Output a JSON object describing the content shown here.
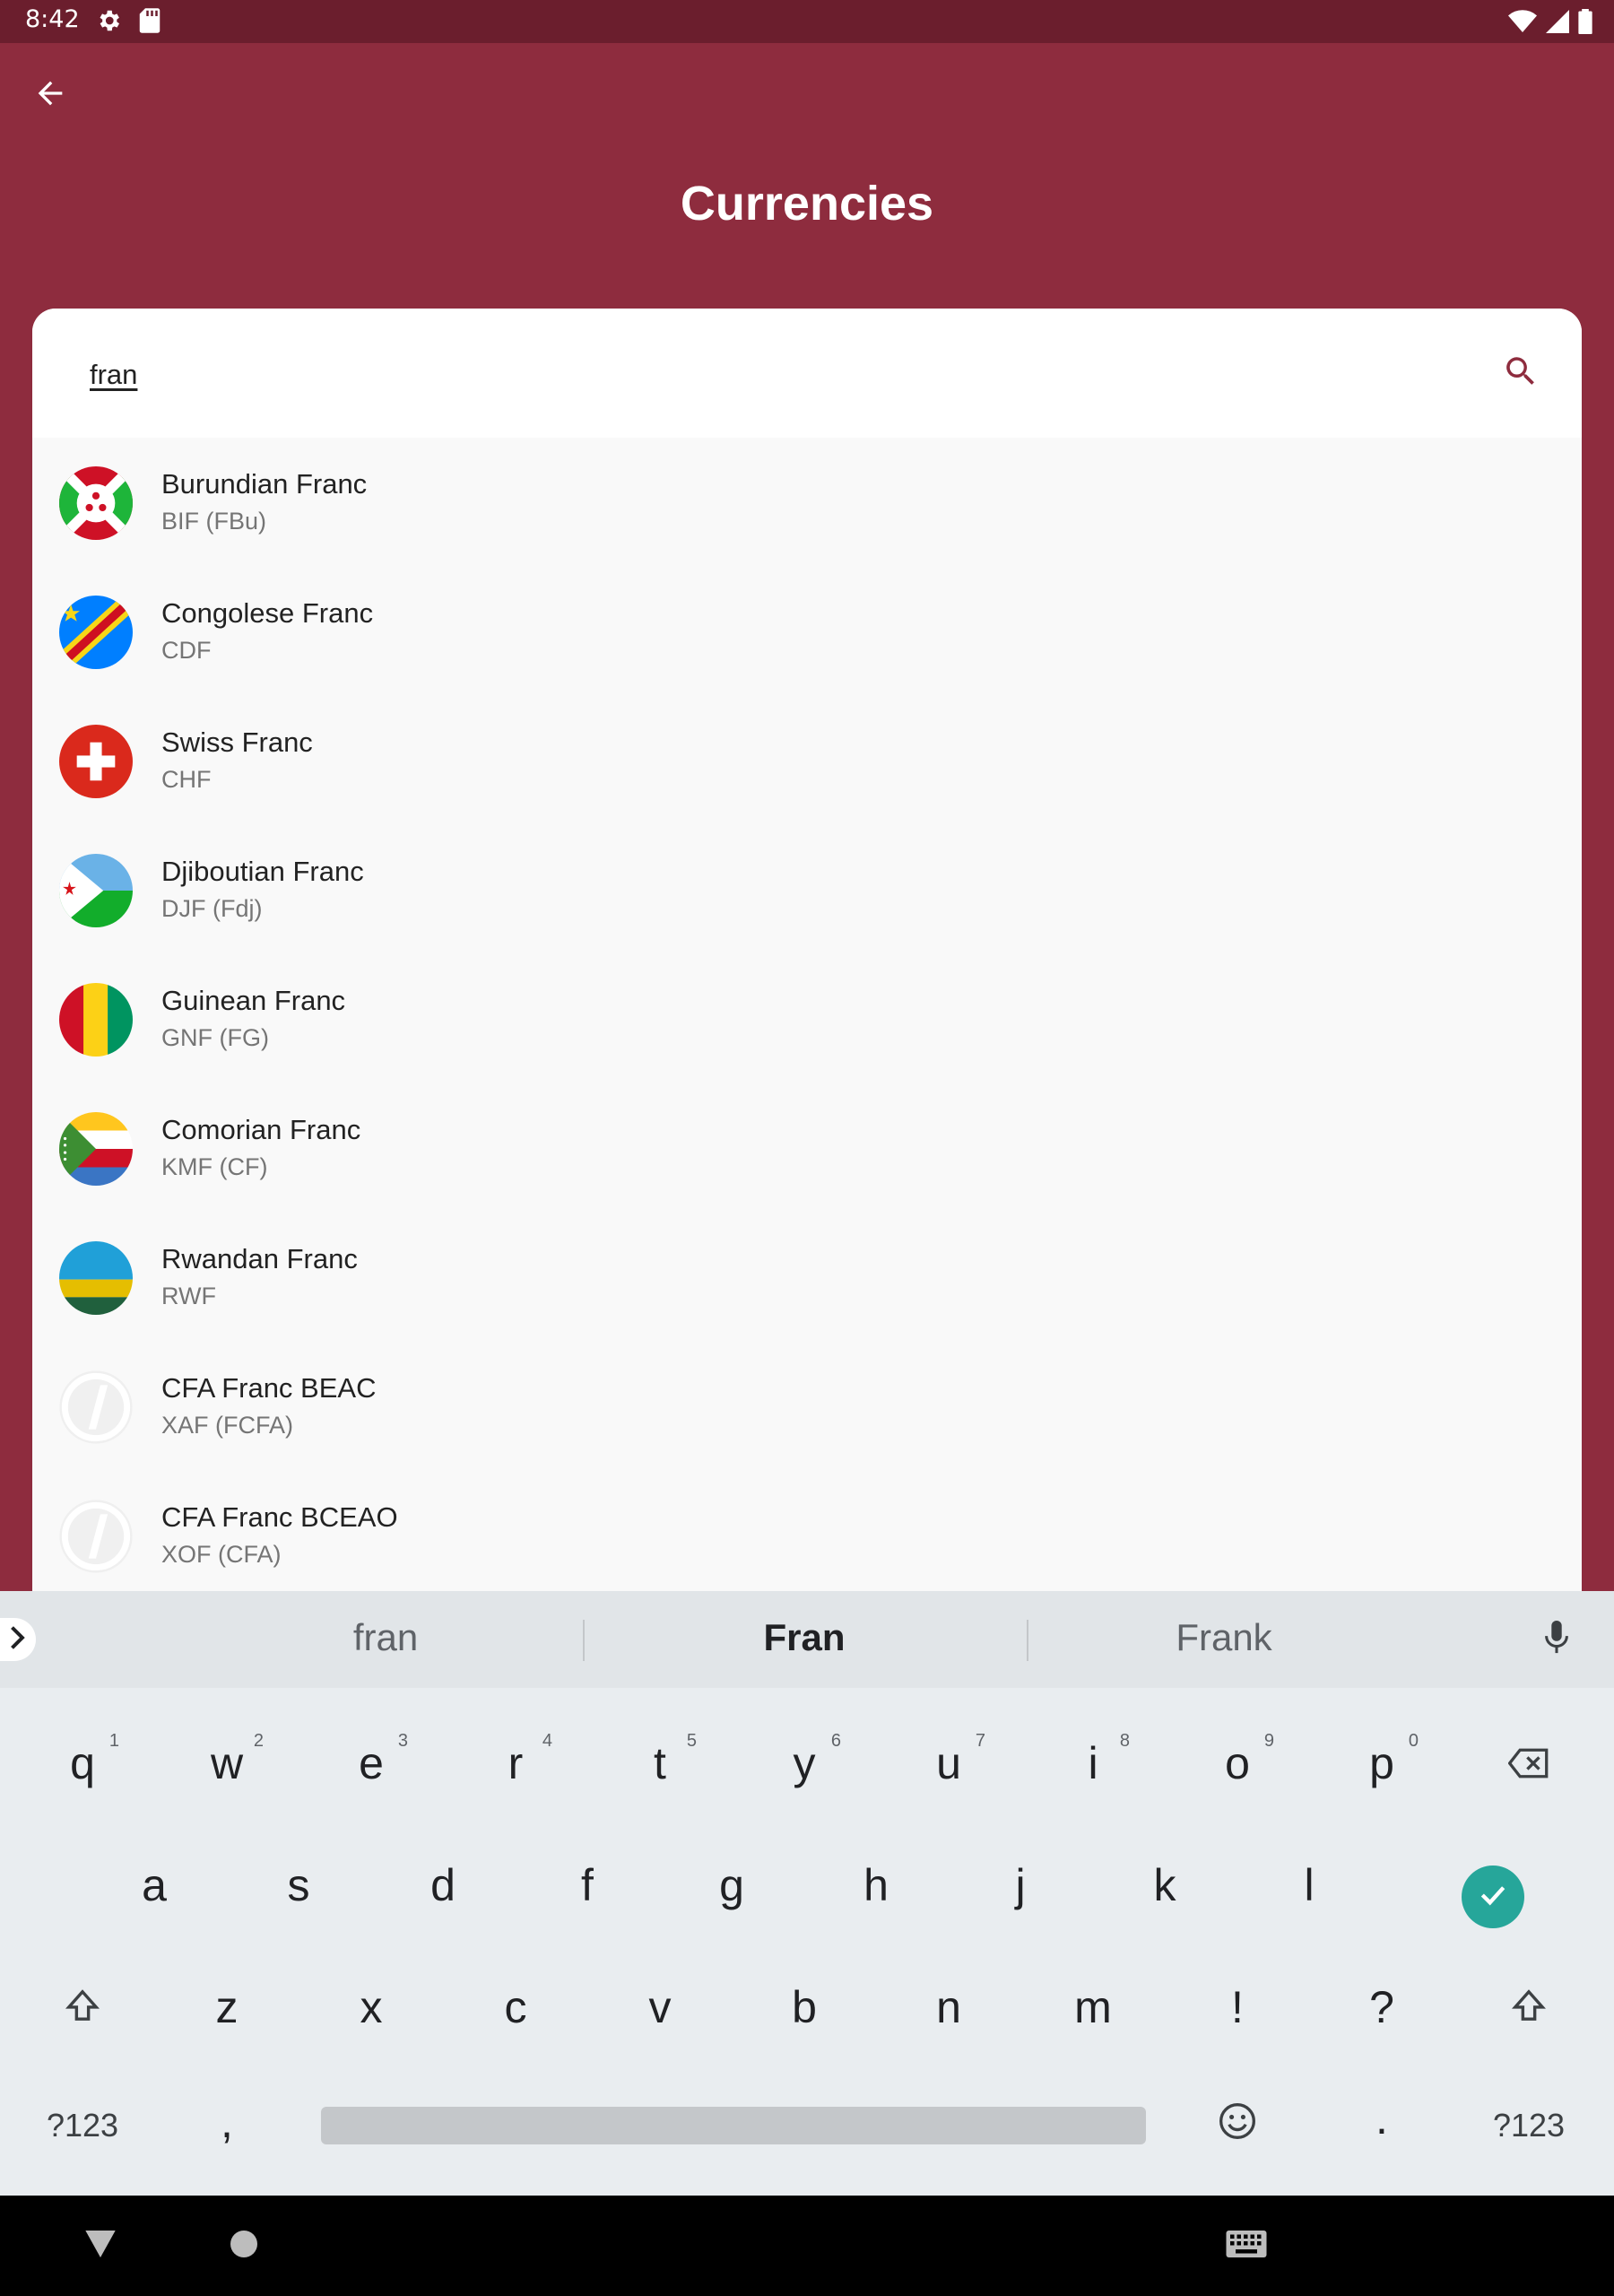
{
  "status_bar": {
    "time": "8:42",
    "left_icons": [
      "gear-icon",
      "sd-card-icon"
    ],
    "right_icons": [
      "wifi-icon",
      "signal-icon",
      "battery-icon"
    ]
  },
  "app_bar": {
    "title": "Currencies",
    "back_icon": "arrow-left-icon",
    "color": "#8e2c3e"
  },
  "search": {
    "value": "fran",
    "icon": "search-icon",
    "icon_color": "#8e2c3e"
  },
  "currencies": [
    {
      "name": "Burundian Franc",
      "code": "BIF (FBu)"
    },
    {
      "name": "Congolese Franc",
      "code": "CDF"
    },
    {
      "name": "Swiss Franc",
      "code": "CHF"
    },
    {
      "name": "Djiboutian Franc",
      "code": "DJF (Fdj)"
    },
    {
      "name": "Guinean Franc",
      "code": "GNF (FG)"
    },
    {
      "name": "Comorian Franc",
      "code": "KMF (CF)"
    },
    {
      "name": "Rwandan Franc",
      "code": "RWF"
    },
    {
      "name": "CFA Franc BEAC",
      "code": "XAF (FCFA)"
    },
    {
      "name": "CFA Franc BCEAO",
      "code": "XOF (CFA)"
    }
  ],
  "keyboard": {
    "suggestions": [
      "fran",
      "Fran",
      "Frank"
    ],
    "row1": [
      "q",
      "w",
      "e",
      "r",
      "t",
      "y",
      "u",
      "i",
      "o",
      "p"
    ],
    "row1_hints": [
      "1",
      "2",
      "3",
      "4",
      "5",
      "6",
      "7",
      "8",
      "9",
      "0"
    ],
    "row2": [
      "a",
      "s",
      "d",
      "f",
      "g",
      "h",
      "j",
      "k",
      "l"
    ],
    "row3": [
      "z",
      "x",
      "c",
      "v",
      "b",
      "n",
      "m",
      "!",
      "?"
    ],
    "symbols_label": "?123",
    "comma": ",",
    "period": ".",
    "enter_color": "#26a69a"
  },
  "nav_bar": {
    "icons": [
      "back-triangle-icon",
      "home-circle-icon",
      "keyboard-icon"
    ]
  }
}
